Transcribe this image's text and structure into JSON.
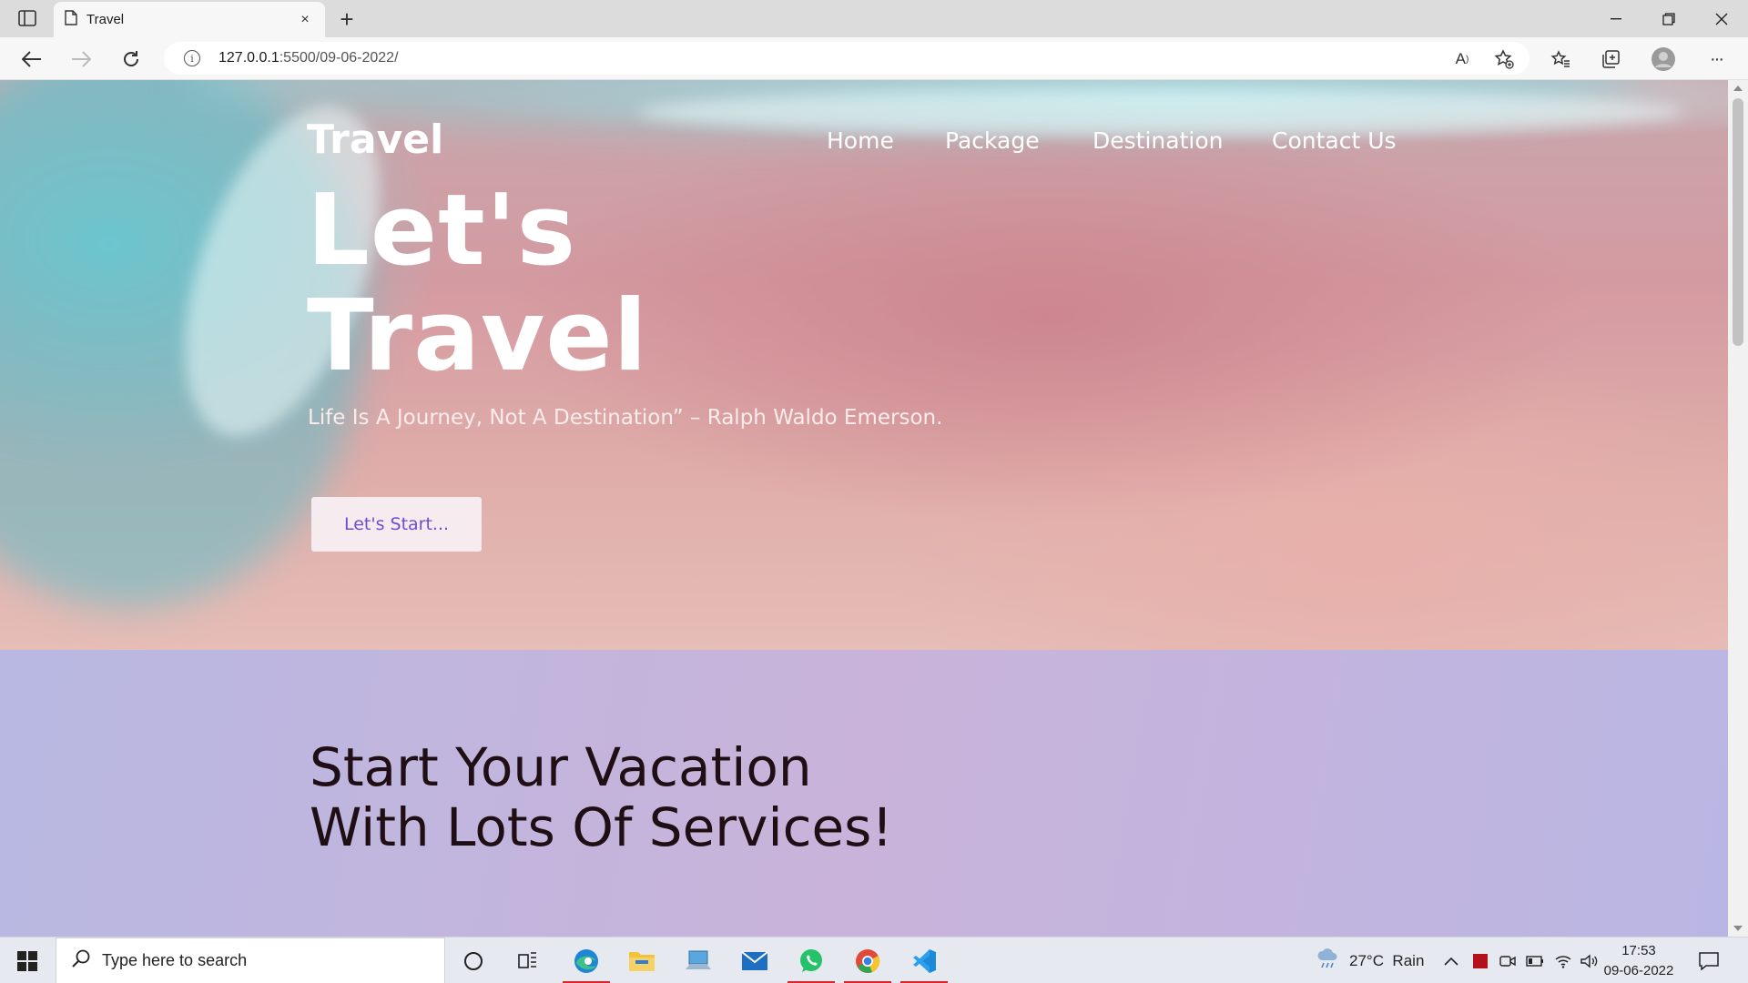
{
  "browser": {
    "tab_title": "Travel",
    "new_tab_symbol": "+",
    "close_tab_symbol": "×",
    "url_host": "127.0.0.1",
    "url_rest": ":5500/09-06-2022/",
    "read_aloud_label": "A",
    "menu_symbol": "···"
  },
  "site": {
    "logo": "Travel",
    "nav": [
      "Home",
      "Package",
      "Destination",
      "Contact Us"
    ],
    "headline_line1": "Let's",
    "headline_line2": "Travel",
    "tagline": "Life Is A Journey, Not A Destination” – Ralph Waldo Emerson.",
    "cta": "Let's Start...",
    "services_heading_line1": "Start Your Vacation",
    "services_heading_line2": "With Lots Of Services!"
  },
  "taskbar": {
    "search_placeholder": "Type here to search",
    "weather": "27°C  Rain",
    "time": "17:53",
    "date": "09-06-2022",
    "pinned": [
      "cortana-icon",
      "task-view-icon",
      "edge-icon",
      "file-explorer-icon",
      "pc-icon",
      "mail-icon",
      "whatsapp-icon",
      "chrome-icon",
      "vscode-icon"
    ]
  },
  "colors": {
    "cta_text": "#6a4fd0",
    "heading_dark": "#1f0f14",
    "taskbar_active": "#d8262d"
  }
}
